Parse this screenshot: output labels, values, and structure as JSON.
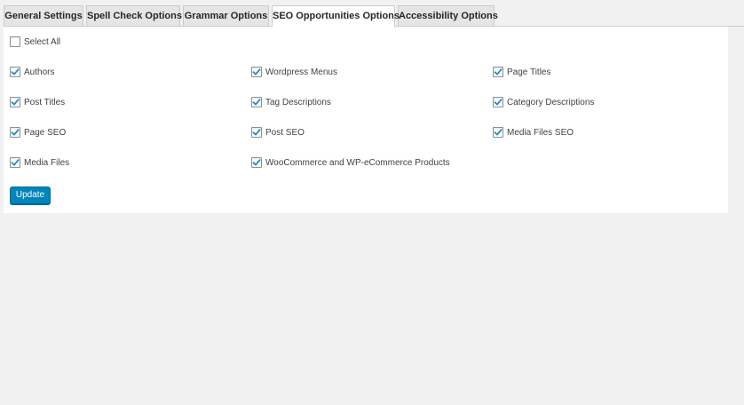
{
  "tabs": [
    {
      "label": "General Settings",
      "active": false
    },
    {
      "label": "Spell Check Options",
      "active": false
    },
    {
      "label": "Grammar Options",
      "active": false
    },
    {
      "label": "SEO Opportunities Options",
      "active": true
    },
    {
      "label": "Accessibility Options",
      "active": false
    }
  ],
  "select_all": {
    "label": "Select All",
    "checked": false
  },
  "options": {
    "col1": [
      {
        "label": "Authors",
        "checked": true
      },
      {
        "label": "Post Titles",
        "checked": true
      },
      {
        "label": "Page SEO",
        "checked": true
      },
      {
        "label": "Media Files",
        "checked": true
      }
    ],
    "col2": [
      {
        "label": "Wordpress Menus",
        "checked": true
      },
      {
        "label": "Tag Descriptions",
        "checked": true
      },
      {
        "label": "Post SEO",
        "checked": true
      },
      {
        "label": "WooCommerce and WP-eCommerce Products",
        "checked": true
      }
    ],
    "col3": [
      {
        "label": "Page Titles",
        "checked": true
      },
      {
        "label": "Category Descriptions",
        "checked": true
      },
      {
        "label": "Media Files SEO",
        "checked": true
      }
    ]
  },
  "update_button": {
    "label": "Update"
  },
  "colors": {
    "accent": "#0085ba",
    "checkmark": "#1e8cbe"
  }
}
